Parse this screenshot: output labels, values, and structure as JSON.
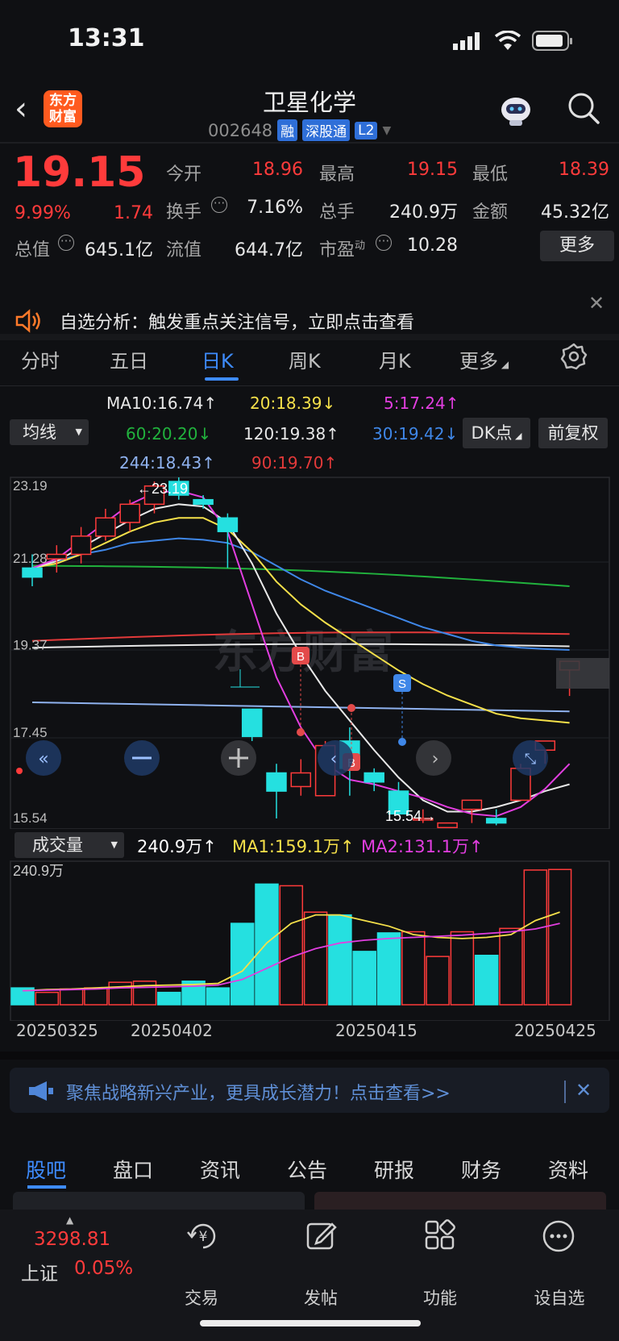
{
  "status": {
    "time": "13:31"
  },
  "header": {
    "title": "卫星化学",
    "code": "002648",
    "tags": [
      "融",
      "深股通",
      "L2"
    ],
    "logo_text": "东方财富"
  },
  "quote": {
    "price": "19.15",
    "pct": "9.99%",
    "change": "1.74",
    "open_label": "今开",
    "open": "18.96",
    "high_label": "最高",
    "high": "19.15",
    "low_label": "最低",
    "low": "18.39",
    "turnover_label": "换手",
    "turnover": "7.16%",
    "volume_label": "总手",
    "volume": "240.9万",
    "amount_label": "金额",
    "amount": "45.32亿",
    "mktcap_label": "总值",
    "mktcap": "645.1亿",
    "float_label": "流值",
    "float": "644.7亿",
    "pe_label": "市盈",
    "pe_sup": "动",
    "pe": "10.28",
    "more": "更多"
  },
  "notice": {
    "text": "自选分析：触发重点关注信号，立即点击查看"
  },
  "tabs": [
    "分时",
    "五日",
    "日K",
    "周K",
    "月K",
    "更多"
  ],
  "ma_legend": {
    "ma10": "MA10:16.74↑",
    "ma20": "20:18.39↓",
    "ma5": "5:17.24↑",
    "ma60": "60:20.20↓",
    "ma120": "120:19.38↑",
    "ma30": "30:19.42↓",
    "ma244": "244:18.43↑",
    "ma90": "90:19.70↑",
    "junxian": "均线",
    "dk": "DK点",
    "fq": "前复权"
  },
  "chart_data": {
    "type": "candlestick",
    "y_ticks": [
      "23.19",
      "21.28",
      "19.37",
      "17.45",
      "15.54"
    ],
    "high_label": "23.19",
    "low_label": "15.54",
    "dates_labels": [
      "20250325",
      "20250402",
      "20250415",
      "20250425"
    ],
    "candles": [
      {
        "o": 21.2,
        "h": 21.5,
        "l": 20.8,
        "c": 21.0
      },
      {
        "o": 21.4,
        "h": 21.7,
        "l": 21.1,
        "c": 21.5
      },
      {
        "o": 21.5,
        "h": 22.1,
        "l": 21.3,
        "c": 21.9
      },
      {
        "o": 21.9,
        "h": 22.5,
        "l": 21.8,
        "c": 22.3
      },
      {
        "o": 22.2,
        "h": 22.7,
        "l": 22.0,
        "c": 22.6
      },
      {
        "o": 22.6,
        "h": 23.1,
        "l": 22.4,
        "c": 23.0
      },
      {
        "o": 23.1,
        "h": 23.19,
        "l": 22.7,
        "c": 22.8
      },
      {
        "o": 22.7,
        "h": 22.8,
        "l": 22.5,
        "c": 22.6
      },
      {
        "o": 22.3,
        "h": 22.4,
        "l": 21.2,
        "c": 22.0
      },
      {
        "o": 18.1,
        "h": 18.1,
        "l": 17.4,
        "c": 17.5
      },
      {
        "o": 16.7,
        "h": 16.9,
        "l": 15.7,
        "c": 16.3
      },
      {
        "o": 16.4,
        "h": 17.0,
        "l": 16.2,
        "c": 16.7
      },
      {
        "o": 16.2,
        "h": 17.4,
        "l": 16.2,
        "c": 17.3
      },
      {
        "o": 17.4,
        "h": 17.7,
        "l": 16.2,
        "c": 16.8
      },
      {
        "o": 16.7,
        "h": 16.8,
        "l": 16.3,
        "c": 16.5
      },
      {
        "o": 16.3,
        "h": 16.5,
        "l": 15.8,
        "c": 15.8
      },
      {
        "o": 15.7,
        "h": 15.9,
        "l": 15.6,
        "c": 15.7
      },
      {
        "o": 15.5,
        "h": 15.6,
        "l": 15.5,
        "c": 15.6
      },
      {
        "o": 15.9,
        "h": 16.1,
        "l": 15.6,
        "c": 16.1
      },
      {
        "o": 15.7,
        "h": 15.9,
        "l": 15.55,
        "c": 15.6
      },
      {
        "o": 16.1,
        "h": 16.9,
        "l": 16.1,
        "c": 16.8
      },
      {
        "o": 17.2,
        "h": 17.4,
        "l": 16.9,
        "c": 17.4
      },
      {
        "o": 18.96,
        "h": 19.15,
        "l": 18.39,
        "c": 19.15
      }
    ],
    "volume": {
      "label": "成交量",
      "value": "240.9万↑",
      "ma1": "MA1:159.1万↑",
      "ma2": "MA2:131.1万↑",
      "max_label": "240.9万",
      "values": [
        30,
        22,
        28,
        30,
        40,
        42,
        22,
        42,
        30,
        145,
        215,
        212,
        165,
        160,
        95,
        128,
        130,
        86,
        130,
        88,
        136,
        240,
        241
      ]
    }
  },
  "banner": {
    "text": "聚焦战略新兴产业，更具成长潜力！点击查看>>"
  },
  "bottom_tabs": [
    "股吧",
    "盘口",
    "资讯",
    "公告",
    "研报",
    "财务",
    "资料"
  ],
  "footer": {
    "index_value": "3298.81",
    "index_name": "上证",
    "index_pct": "0.05%",
    "items": [
      "交易",
      "发帖",
      "功能",
      "设自选"
    ]
  }
}
